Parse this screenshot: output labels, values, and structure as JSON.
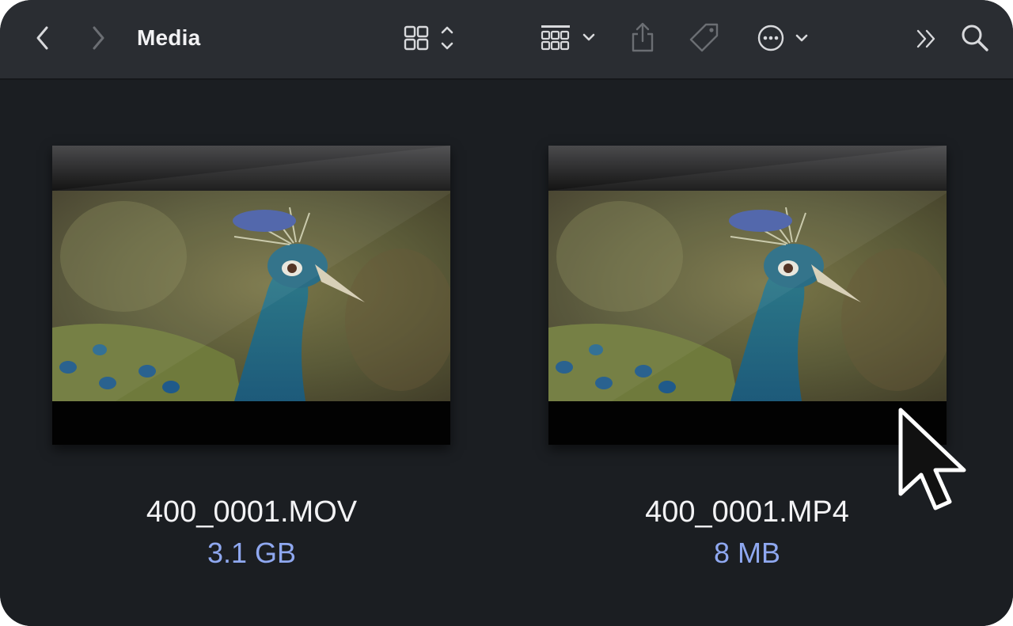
{
  "window": {
    "title": "Media"
  },
  "toolbar": {
    "buttons": [
      {
        "name": "back-button",
        "icon": "chevron-left-icon"
      },
      {
        "name": "forward-button",
        "icon": "chevron-right-icon"
      },
      {
        "name": "view-options-button",
        "icon": "grid-view-icon"
      },
      {
        "name": "group-options-button",
        "icon": "filmstrip-group-icon"
      },
      {
        "name": "share-button",
        "icon": "share-icon"
      },
      {
        "name": "tag-button",
        "icon": "tag-icon"
      },
      {
        "name": "more-actions-button",
        "icon": "ellipsis-circle-icon"
      },
      {
        "name": "overflow-button",
        "icon": "double-chevron-right-icon"
      },
      {
        "name": "search-button",
        "icon": "magnifying-glass-icon"
      }
    ]
  },
  "files": [
    {
      "name": "400_0001.MOV",
      "size": "3.1 GB",
      "thumbnail": "peacock video frame"
    },
    {
      "name": "400_0001.MP4",
      "size": "8 MB",
      "thumbnail": "peacock video frame"
    }
  ],
  "colors": {
    "window_bg": "#1b1e22",
    "toolbar_bg": "#2a2d32",
    "title_text": "#f2f2f4",
    "size_text": "#8fa8f0",
    "icon_active": "#d8d9dc",
    "icon_disabled": "#6b6e73"
  },
  "pointer": {
    "icon": "arrow-cursor-icon"
  }
}
